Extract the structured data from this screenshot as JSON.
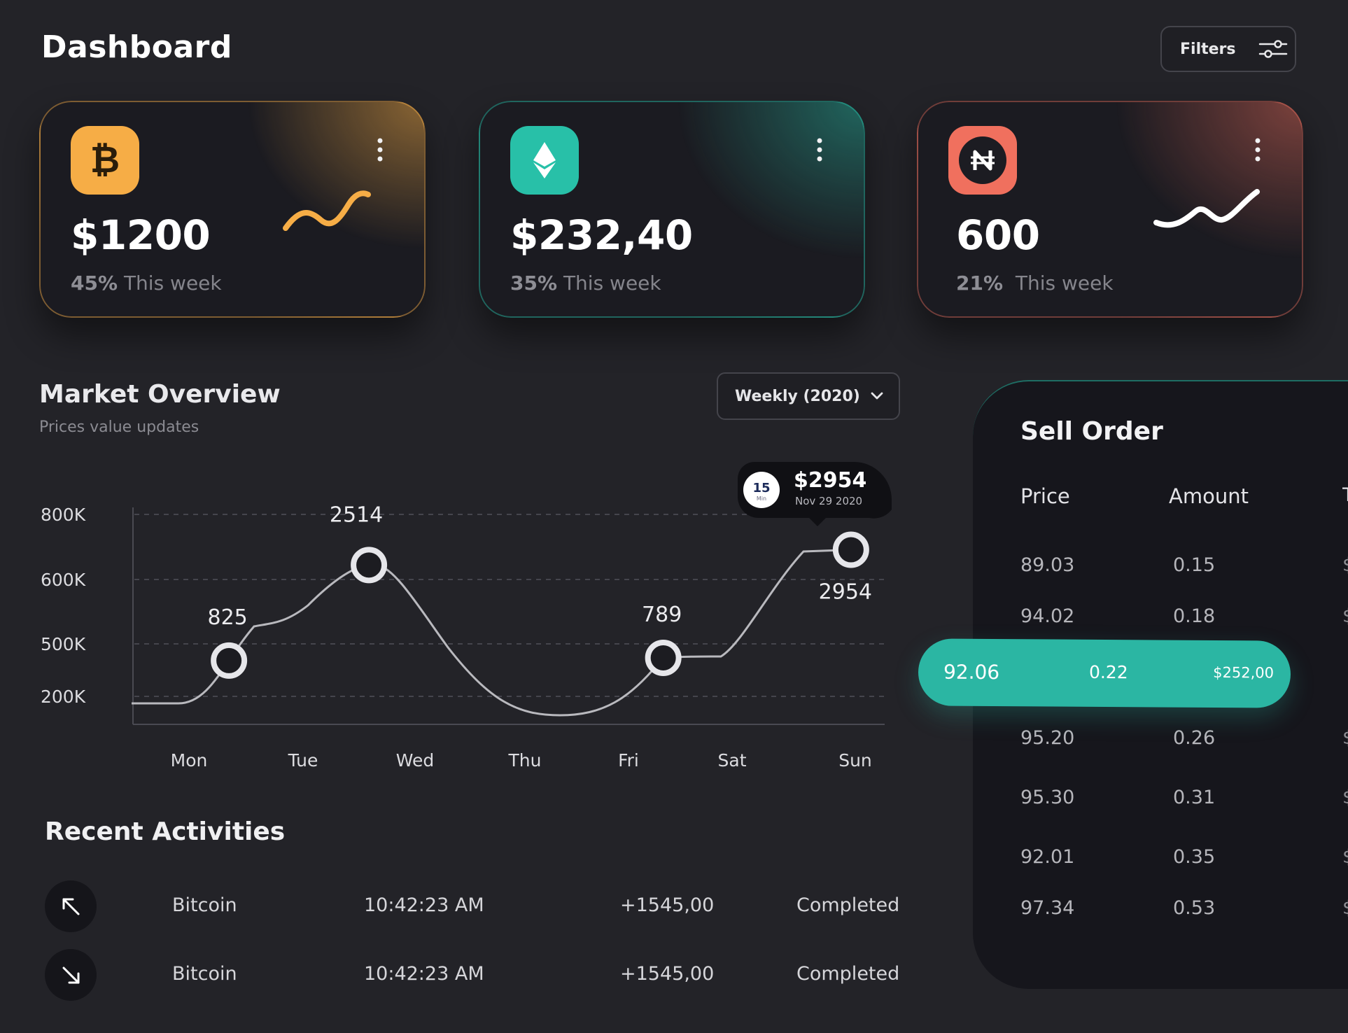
{
  "header": {
    "title": "Dashboard",
    "filters_label": "Filters"
  },
  "cards": [
    {
      "value": "$1200",
      "percent": "45%",
      "period": "This week",
      "icon": "bitcoin-icon",
      "accent": "#f6ad46"
    },
    {
      "value": "$232,40",
      "percent": "35%",
      "period": "This week",
      "icon": "ethereum-icon",
      "accent": "#28c0a8"
    },
    {
      "value": "600",
      "percent": "21%",
      "period": "This week",
      "icon": "nano-icon",
      "accent": "#f0705e"
    }
  ],
  "market": {
    "title": "Market Overview",
    "subtitle": "Prices value updates",
    "period": "Weekly (2020)"
  },
  "chart_data": {
    "type": "line",
    "categories": [
      "Mon",
      "Tue",
      "Wed",
      "Thu",
      "Fri",
      "Sat",
      "Sun"
    ],
    "y_ticks": [
      "800K",
      "600K",
      "500K",
      "200K"
    ],
    "grid": true,
    "points": [
      {
        "label": "825",
        "x_pos": 0.36
      },
      {
        "label": "2514",
        "x_pos": 1.62
      },
      {
        "label": "789",
        "x_pos": 4.27
      },
      {
        "label": "2954",
        "x_pos": 5.96
      }
    ],
    "tooltip": {
      "value": "$2954",
      "date": "Nov 29 2020",
      "badge": "15",
      "badge_unit": "Min"
    }
  },
  "activities": {
    "title": "Recent Activities",
    "rows": [
      {
        "direction": "arrow-up-left-icon",
        "coin": "Bitcoin",
        "time": "10:42:23 AM",
        "amount": "+1545,00",
        "status": "Completed"
      },
      {
        "direction": "arrow-down-right-icon",
        "coin": "Bitcoin",
        "time": "10:42:23 AM",
        "amount": "+1545,00",
        "status": "Completed"
      }
    ]
  },
  "sell_order": {
    "title": "Sell Order",
    "columns": [
      "Price",
      "Amount"
    ],
    "rows": [
      {
        "price": "89.03",
        "amount": "0.15"
      },
      {
        "price": "94.02",
        "amount": "0.18"
      },
      {
        "price": "95.20",
        "amount": "0.26"
      },
      {
        "price": "95.30",
        "amount": "0.31"
      },
      {
        "price": "92.01",
        "amount": "0.35"
      },
      {
        "price": "97.34",
        "amount": "0.53"
      }
    ],
    "highlight": {
      "price": "92.06",
      "amount": "0.22",
      "total": "$252,00"
    }
  }
}
